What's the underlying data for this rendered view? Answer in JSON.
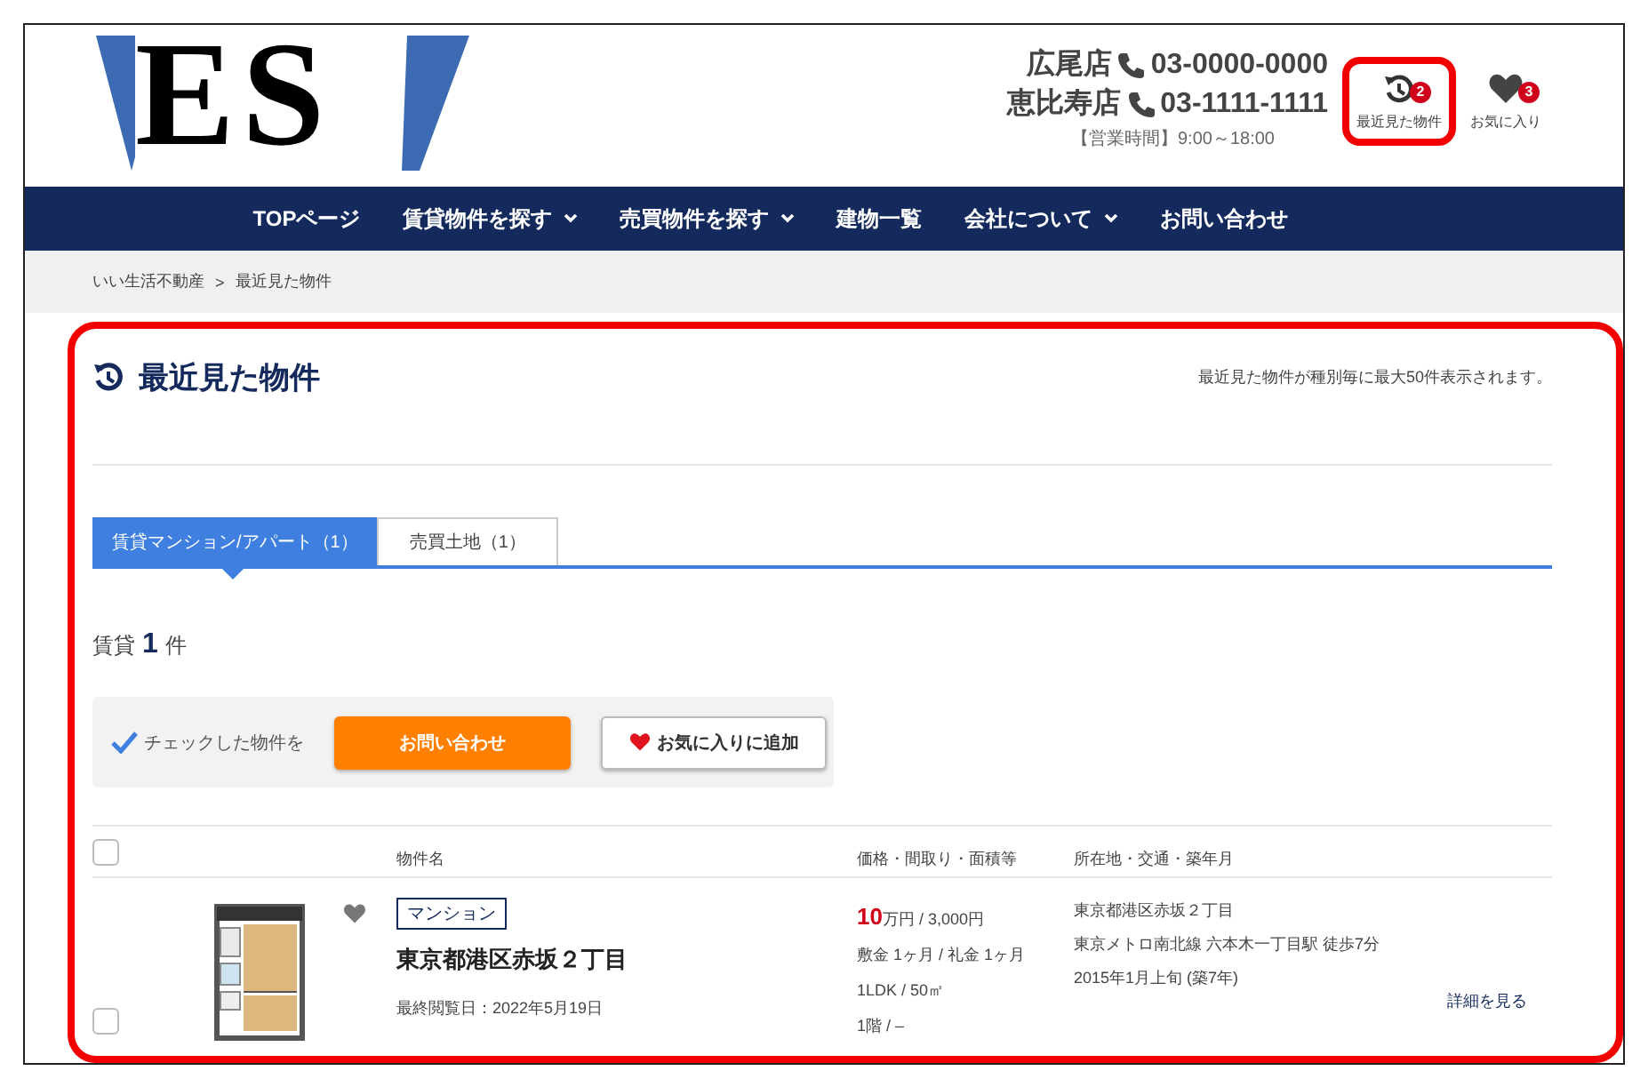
{
  "logo": {
    "text": "ES"
  },
  "shops": [
    {
      "name": "広尾店",
      "phone": "03-0000-0000"
    },
    {
      "name": "恵比寿店",
      "phone": "03-1111-1111"
    }
  ],
  "hours": "【営業時間】9:00～18:00",
  "header_links": [
    {
      "kind": "recent",
      "label": "最近見た物件",
      "badge": "2",
      "highlighted": true
    },
    {
      "kind": "favorite",
      "label": "お気に入り",
      "badge": "3",
      "highlighted": false
    }
  ],
  "nav": [
    {
      "label": "TOPページ",
      "dropdown": false
    },
    {
      "label": "賃貸物件を探す",
      "dropdown": true
    },
    {
      "label": "売買物件を探す",
      "dropdown": true
    },
    {
      "label": "建物一覧",
      "dropdown": false
    },
    {
      "label": "会社について",
      "dropdown": true
    },
    {
      "label": "お問い合わせ",
      "dropdown": false
    }
  ],
  "breadcrumb": {
    "items": [
      "いい生活不動産",
      "最近見た物件"
    ],
    "separator": ">"
  },
  "page": {
    "title": "最近見た物件",
    "note": "最近見た物件が種別毎に最大50件表示されます。",
    "highlighted": true
  },
  "tabs": [
    {
      "label": "賃貸マンション/アパート（1）",
      "selected": true
    },
    {
      "label": "売買土地（1）",
      "selected": false
    }
  ],
  "count": {
    "prefix": "賃貸",
    "number": "1",
    "suffix": "件"
  },
  "actions": {
    "label": "チェックした物件を",
    "buttons": [
      {
        "kind": "inquiry",
        "label": "お問い合わせ"
      },
      {
        "kind": "favorite",
        "label": "お気に入りに追加"
      }
    ]
  },
  "table": {
    "select_all_checked": false,
    "columns": [
      "物件名",
      "価格・間取り・面積等",
      "所在地・交通・築年月"
    ],
    "rows": [
      {
        "checked": false,
        "favorited": false,
        "tag": "マンション",
        "name": "東京都港区赤坂２丁目",
        "last_viewed": "最終閲覧日：2022年5月19日",
        "price": "10",
        "price_rest": "万円 / 3,000円",
        "deposit": "敷金 1ヶ月 / 礼金 1ヶ月",
        "layout": "1LDK / 50㎡",
        "floor": "1階 / –",
        "address": "東京都港区赤坂２丁目",
        "access": "東京メトロ南北線 六本木一丁目駅 徒歩7分",
        "built": "2015年1月上旬 (築7年)",
        "detail_link": "詳細を見る"
      }
    ]
  }
}
